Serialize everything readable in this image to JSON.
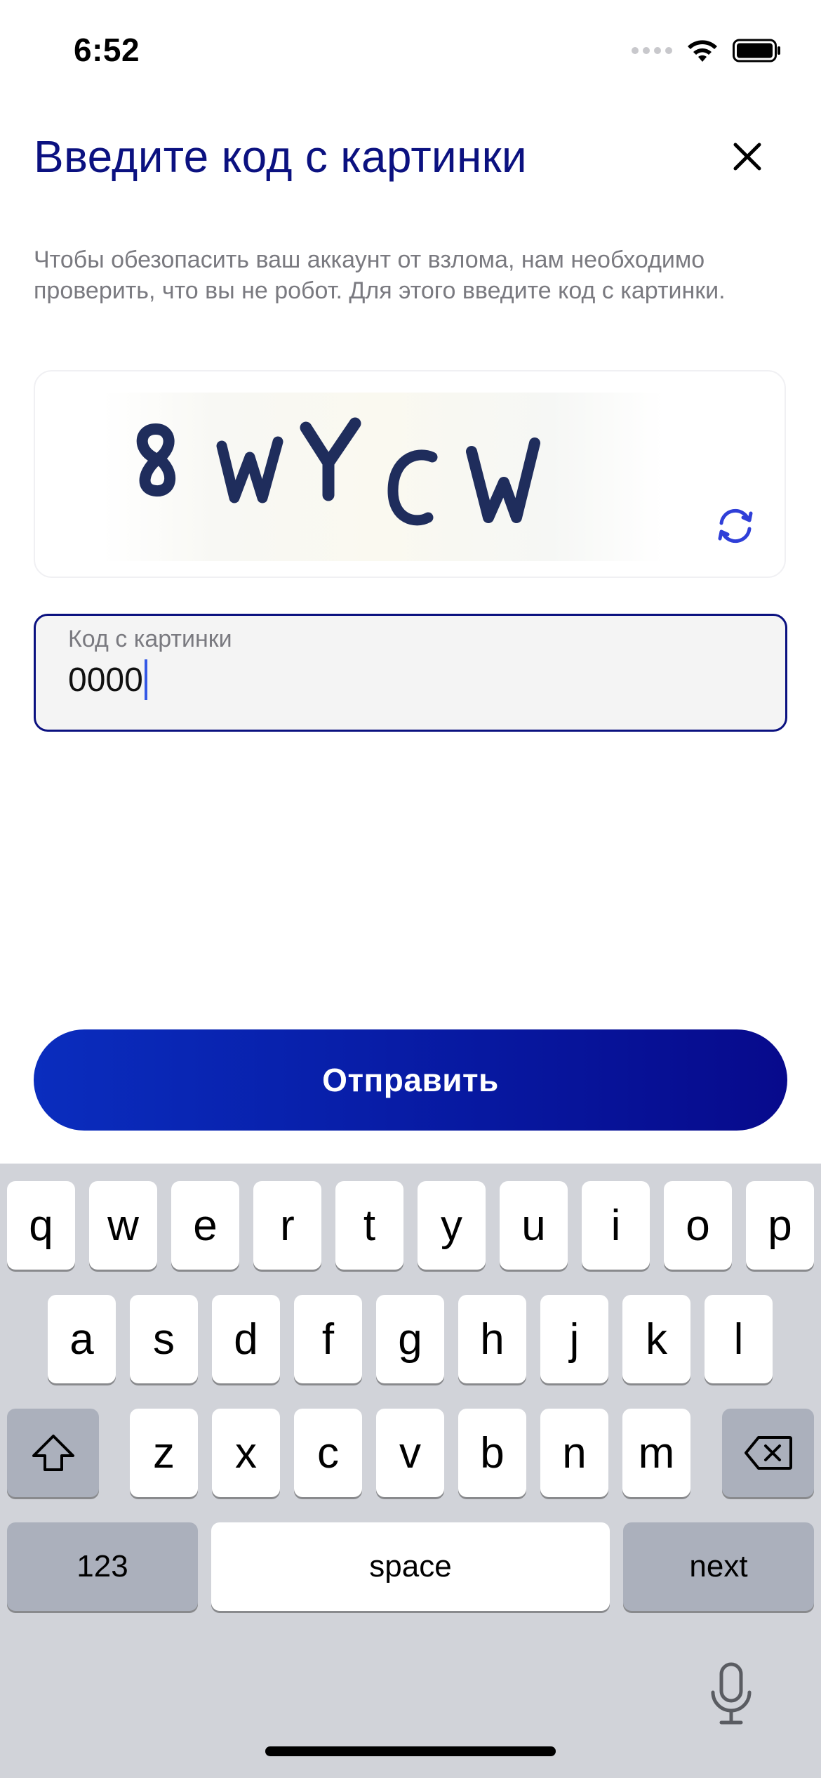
{
  "status_bar": {
    "time": "6:52"
  },
  "header": {
    "title": "Введите код с картинки"
  },
  "description": "Чтобы обезопасить ваш аккаунт от взлома, нам необходимо проверить, что вы не робот. Для этого введите код с картинки.",
  "captcha": {
    "text": "8WYCW"
  },
  "code_field": {
    "label": "Код с картинки",
    "value": "0000"
  },
  "submit": {
    "label": "Отправить"
  },
  "colors": {
    "accent": "#0b1180",
    "button_start": "#0a2dbe",
    "button_end": "#070a8c",
    "caret": "#3458e6"
  },
  "keyboard": {
    "row1": [
      "q",
      "w",
      "e",
      "r",
      "t",
      "y",
      "u",
      "i",
      "o",
      "p"
    ],
    "row2": [
      "a",
      "s",
      "d",
      "f",
      "g",
      "h",
      "j",
      "k",
      "l"
    ],
    "row3": [
      "z",
      "x",
      "c",
      "v",
      "b",
      "n",
      "m"
    ],
    "numbers_label": "123",
    "space_label": "space",
    "next_label": "next"
  }
}
